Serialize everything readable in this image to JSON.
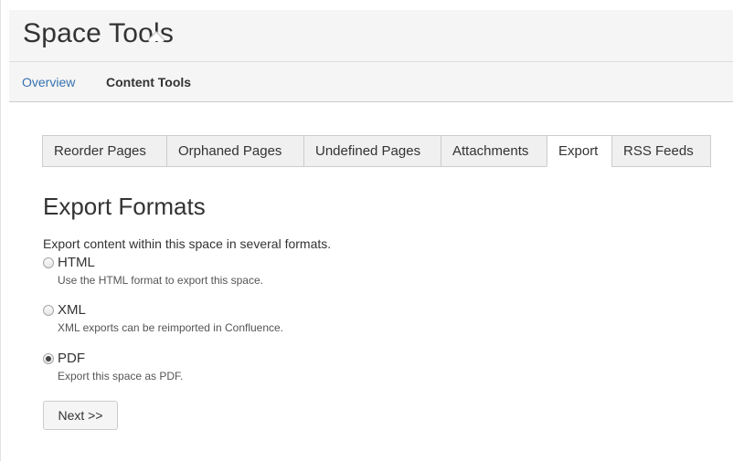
{
  "header": {
    "title": "Space Tools"
  },
  "subnav": {
    "overview": "Overview",
    "content_tools": "Content Tools"
  },
  "tabs": [
    {
      "label": "Reorder Pages"
    },
    {
      "label": "Orphaned Pages"
    },
    {
      "label": "Undefined Pages"
    },
    {
      "label": "Attachments"
    },
    {
      "label": "Export",
      "active": true
    },
    {
      "label": "RSS Feeds"
    }
  ],
  "main": {
    "title": "Export Formats",
    "intro": "Export content within this space in several formats.",
    "options": [
      {
        "label": "HTML",
        "desc": "Use the HTML format to export this space.",
        "checked": false
      },
      {
        "label": "XML",
        "desc": "XML exports can be reimported in Confluence.",
        "checked": false
      },
      {
        "label": "PDF",
        "desc": "Export this space as PDF.",
        "checked": true
      }
    ],
    "next_label": "Next >>"
  }
}
